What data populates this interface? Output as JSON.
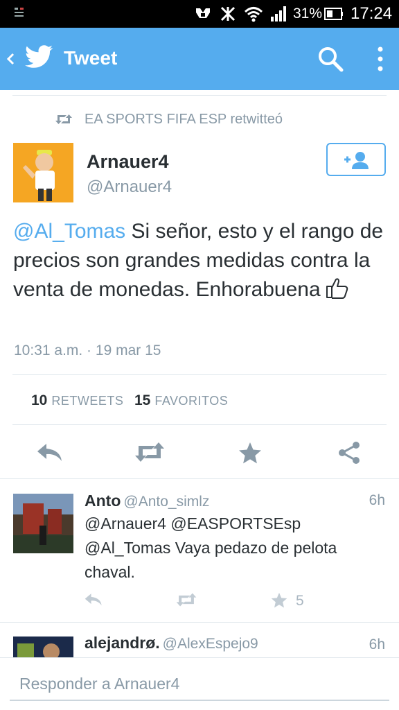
{
  "status_bar": {
    "battery_percent": "31%",
    "time": "17:24",
    "icons": [
      "notification-icon",
      "nfc-icon",
      "mute-icon",
      "wifi-icon",
      "signal-icon",
      "battery-icon"
    ]
  },
  "app_bar": {
    "title": "Tweet",
    "icons": [
      "back-icon",
      "twitter-bird-icon",
      "search-icon",
      "overflow-menu-icon"
    ]
  },
  "tweet": {
    "retweet_context": "EA SPORTS FIFA ESP retwitteó",
    "author_name": "Arnauer4",
    "author_handle": "@Arnauer4",
    "text_mention": "@Al_Tomas",
    "text_body": " Si señor,  esto y el rango de precios son grandes medidas contra la venta de monedas. Enhorabuena",
    "timestamp": "10:31 a.m. · 19 mar 15",
    "retweets_count": "10",
    "retweets_label": "RETWEETS",
    "favorites_count": "15",
    "favorites_label": "FAVORITOS"
  },
  "replies": [
    {
      "name": "Anto",
      "handle": "@Anto_simlz",
      "time": "6h",
      "text": "@Arnauer4 @EASPORTSEsp @Al_Tomas Vaya pedazo de pelota chaval.",
      "favorites": "5"
    },
    {
      "name": "alejandrø.",
      "handle": "@AlexEspejo9",
      "time": "6h"
    }
  ],
  "compose": {
    "placeholder": "Responder a Arnauer4"
  },
  "colors": {
    "brand_blue": "#55acee",
    "text_dark": "#292f33",
    "text_muted": "#8899a6"
  }
}
